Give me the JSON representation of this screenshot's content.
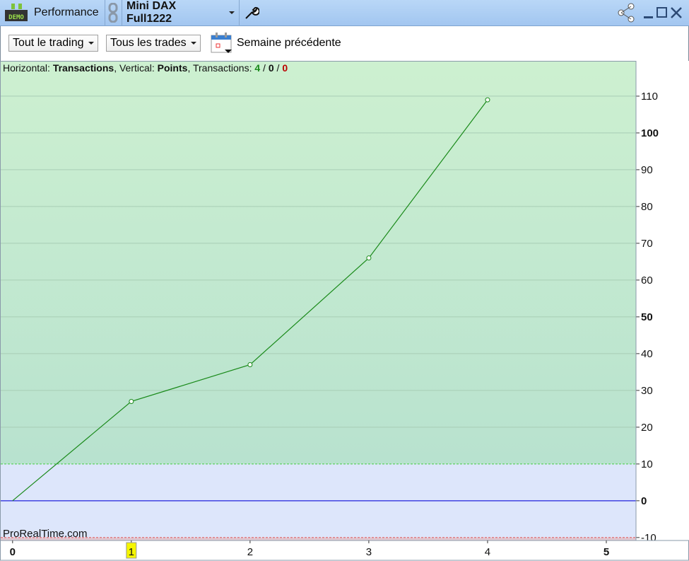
{
  "titlebar": {
    "app_label": "Performance",
    "instrument": "Mini DAX Full1222",
    "demo_badge": "DEMO"
  },
  "toolbar": {
    "scope_select": "Tout le trading",
    "trades_select": "Tous les trades",
    "period_label": "Semaine précédente"
  },
  "info": {
    "h_label": "Horizontal: ",
    "h_value": "Transactions",
    "v_label": ", Vertical: ",
    "v_value": "Points",
    "t_label": ", Transactions: ",
    "wins": "4",
    "sep1": " / ",
    "neutral": "0",
    "sep2": " / ",
    "losses": "0"
  },
  "colors": {
    "win": "#1a8a1a",
    "loss": "#cc0000",
    "line": "#1a8a1a",
    "zero": "#2222dd"
  },
  "watermark": "ProRealTime.com",
  "chart_data": {
    "type": "line",
    "x": [
      0,
      1,
      2,
      3,
      4
    ],
    "y": [
      0,
      27,
      37,
      66,
      109
    ],
    "xlabel": "Transactions",
    "ylabel": "Points",
    "yticks": [
      -10,
      0,
      10,
      20,
      30,
      40,
      50,
      60,
      70,
      80,
      90,
      100,
      110
    ],
    "xticks": [
      0,
      1,
      2,
      3,
      4,
      5
    ],
    "ylim": [
      -10.8,
      119.6
    ],
    "xlim": [
      -0.1,
      5.25
    ],
    "highlighted_xtick": 1,
    "threshold_upper": 10,
    "threshold_lower": -10
  }
}
